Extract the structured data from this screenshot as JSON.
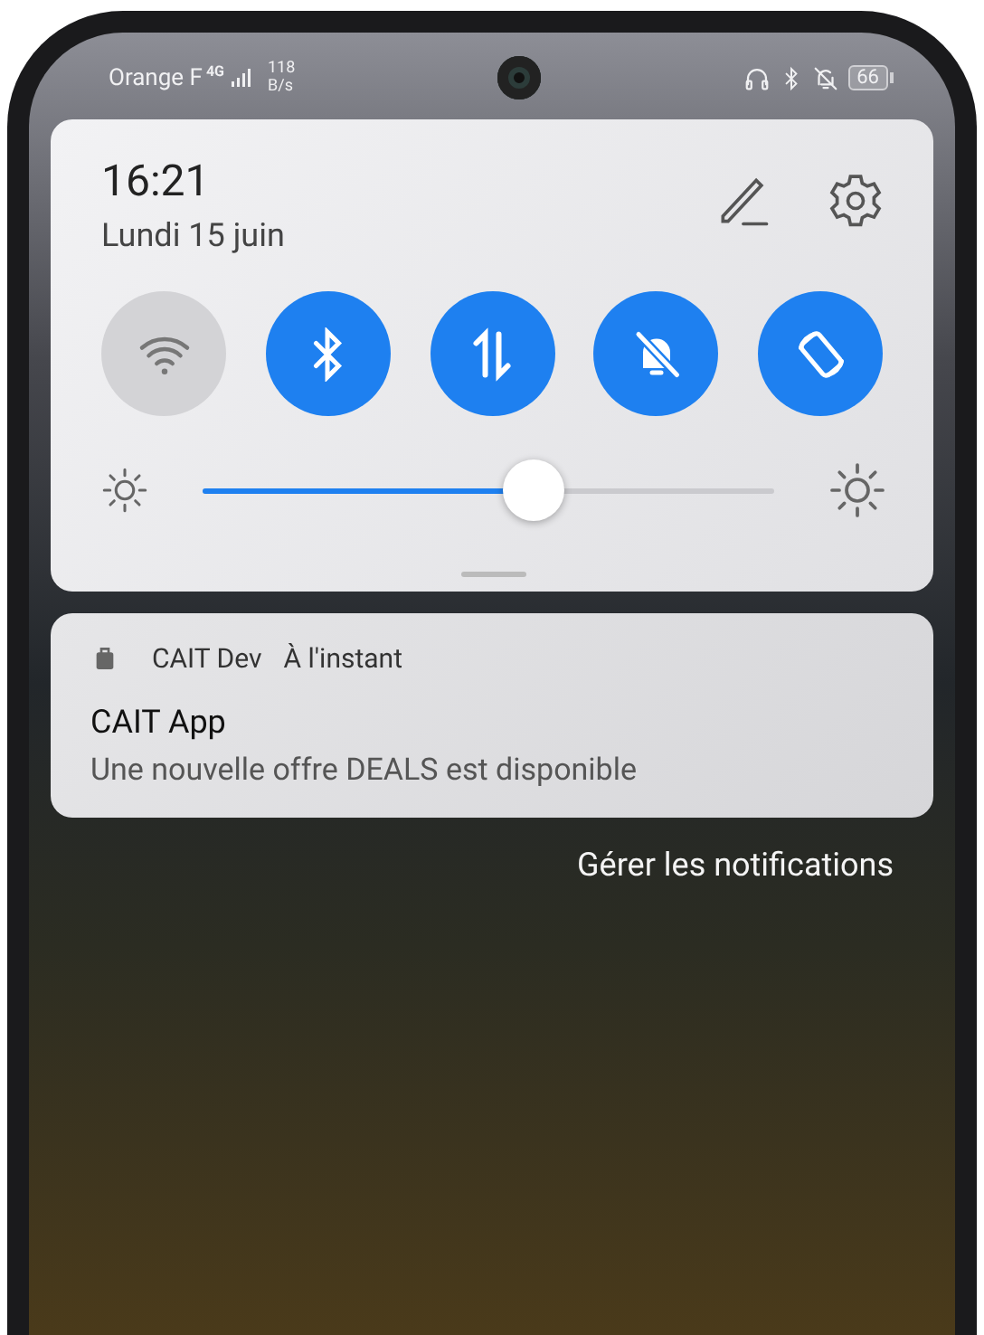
{
  "status_bar": {
    "carrier": "Orange F",
    "network": "4G",
    "speed_value": "118",
    "speed_unit": "B/s",
    "battery": "66"
  },
  "quick_settings": {
    "time": "16:21",
    "date": "Lundi 15 juin",
    "toggles": [
      {
        "kind": "wifi",
        "on": false
      },
      {
        "kind": "bluetooth",
        "on": true
      },
      {
        "kind": "data",
        "on": true
      },
      {
        "kind": "silent",
        "on": true
      },
      {
        "kind": "rotate",
        "on": true
      }
    ],
    "brightness": {
      "level": 0.58
    }
  },
  "notification": {
    "app": "CAIT Dev",
    "time": "À l'instant",
    "title": "CAIT App",
    "body": "Une nouvelle offre DEALS est disponible"
  },
  "manage_link": "Gérer les notifications"
}
